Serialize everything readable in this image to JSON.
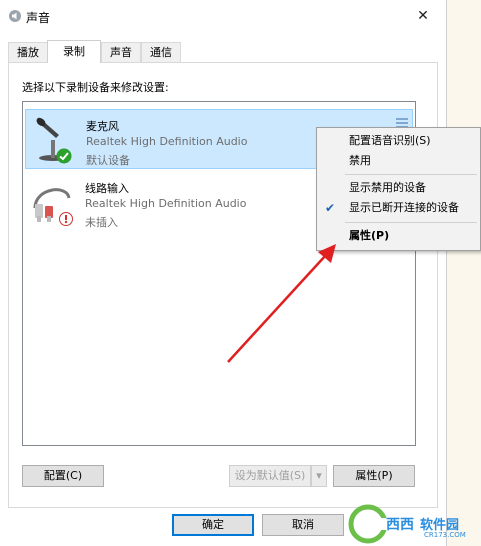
{
  "window": {
    "title": "声音",
    "close_glyph": "✕"
  },
  "tabs": [
    {
      "label": "播放"
    },
    {
      "label": "录制"
    },
    {
      "label": "声音"
    },
    {
      "label": "通信"
    }
  ],
  "instruction": "选择以下录制设备来修改设置:",
  "devices": [
    {
      "name": "麦克风",
      "description": "Realtek High Definition Audio",
      "status": "默认设备",
      "icon": "microphone-icon",
      "badge": "default-check-icon"
    },
    {
      "name": "线路输入",
      "description": "Realtek High Definition Audio",
      "status": "未插入",
      "icon": "line-in-icon",
      "badge": "unplugged-icon"
    }
  ],
  "buttons": {
    "configure": "配置(C)",
    "set_default": "设为默认值(S)",
    "dropdown_glyph": "▾",
    "properties": "属性(P)",
    "ok": "确定",
    "cancel": "取消"
  },
  "context_menu": [
    {
      "label": "配置语音识别(S)",
      "checked": false
    },
    {
      "label": "禁用",
      "checked": false
    },
    {
      "label": "显示禁用的设备",
      "checked": false
    },
    {
      "label": "显示已断开连接的设备",
      "checked": true
    },
    {
      "label": "属性(P)",
      "checked": false,
      "bold": true
    }
  ],
  "check_glyph": "✔",
  "watermark": {
    "brand": "西西",
    "suffix": "软件园",
    "sub": "CR173.COM"
  },
  "colors": {
    "selection": "#cce8ff",
    "accent": "#0078d7",
    "arrow": "#e02020"
  }
}
